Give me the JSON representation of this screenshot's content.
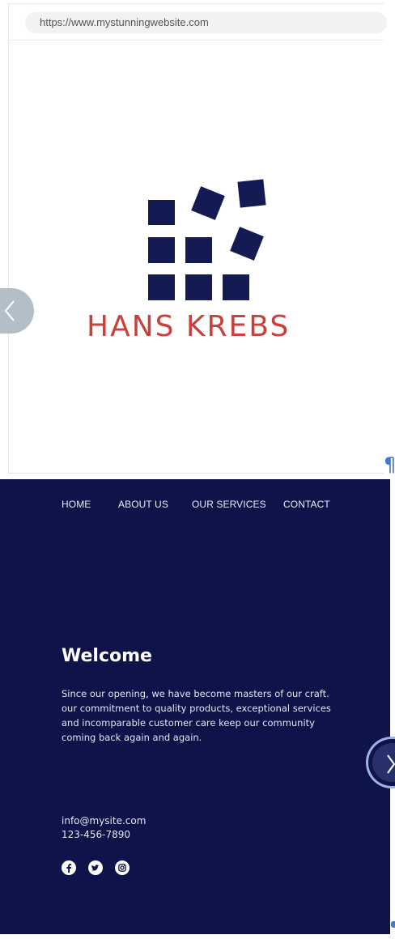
{
  "browser": {
    "url": "https://www.mystunningwebsite.com"
  },
  "logo": {
    "brand_text": "HANS KREBS",
    "icon": "grid-squares-logo-icon",
    "mark_color": "#141a52",
    "text_color": "#c8413a"
  },
  "carousel": {
    "prev_icon": "chevron-left-icon",
    "next_icon": "chevron-right-icon"
  },
  "pilcrow_mark": "¶",
  "site": {
    "background": "#0e1449",
    "nav": [
      {
        "label": "HOME"
      },
      {
        "label": "ABOUT US"
      },
      {
        "label": "OUR SERVICES"
      },
      {
        "label": "CONTACT"
      }
    ],
    "welcome_title": "Welcome",
    "welcome_text": "Since our opening, we have become masters of our craft. our commitment to quality products, exceptional services and incomparable customer care keep our community coming back again and again.",
    "email": "info@mysite.com",
    "phone": "123-456-7890",
    "social": [
      {
        "icon": "facebook-icon"
      },
      {
        "icon": "twitter-icon"
      },
      {
        "icon": "instagram-icon"
      }
    ]
  }
}
